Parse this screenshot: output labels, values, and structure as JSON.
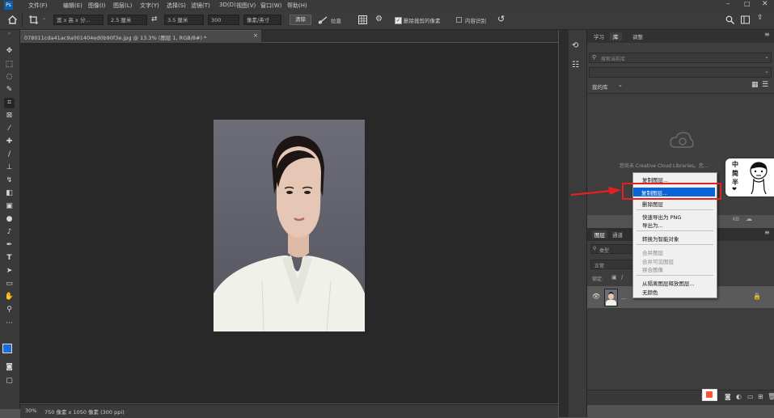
{
  "menu": [
    "文件(F)",
    "编辑(E)",
    "图像(I)",
    "图层(L)",
    "文字(Y)",
    "选择(S)",
    "滤镜(T)",
    "3D(D)",
    "视图(V)",
    "窗口(W)",
    "帮助(H)"
  ],
  "options": {
    "ratio": "宽 x 高 x 分...",
    "width_field": "2.5 厘米",
    "height_field": "3.5 厘米",
    "resolution_field": "300",
    "unit_select": "像素/英寸",
    "clear_label": "清除",
    "straighten_label": "拉直",
    "delete_cropped_label": "删除裁剪的像素",
    "content_aware_label": "内容识别"
  },
  "document": {
    "tab_title": "078011cda41ac9a001404ed0b90f3e.jpg @ 13.3% (图层 1, RGB/8#) *",
    "status_zoom": "30%",
    "status_info": "750 像素 x 1050 像素 (300 ppi)"
  },
  "libraries_panel": {
    "tab_learn": "学习",
    "tab_libraries": "库",
    "tab_adjust": "调整",
    "search_placeholder": "搜索当前库",
    "library_select": "我的库",
    "message": "您尚未 Creative Cloud Libraries。您..."
  },
  "layers_panel": {
    "tab_layers": "图层",
    "tab_channels": "通道",
    "kind_placeholder": "类型",
    "mode_label": "正常",
    "layer_name": "..."
  },
  "context_menu": {
    "items": [
      {
        "label": "复制图层...",
        "enabled": true
      },
      {
        "label": "复制图层...",
        "enabled": true,
        "highlighted": true
      },
      {
        "label": "删除图层",
        "enabled": true
      },
      {
        "label": "快速导出为 PNG",
        "enabled": true
      },
      {
        "label": "导出为...",
        "enabled": true
      },
      {
        "label": "转换为智能对象",
        "enabled": true
      },
      {
        "label": "合并图层",
        "enabled": false
      },
      {
        "label": "合并可见图层",
        "enabled": false
      },
      {
        "label": "拼合图像",
        "enabled": false
      },
      {
        "label": "从隔离图层释放图层...",
        "enabled": true
      },
      {
        "label": "无颜色",
        "enabled": true
      }
    ]
  },
  "side_sticker": {
    "text1": "中",
    "text2": "简",
    "text3": "半",
    "heart": "❤"
  },
  "colors": {
    "accent": "#0a64d6",
    "annotation": "#e62020",
    "canvas_bg": "#282828",
    "panel_bg": "#3f3f3f"
  }
}
